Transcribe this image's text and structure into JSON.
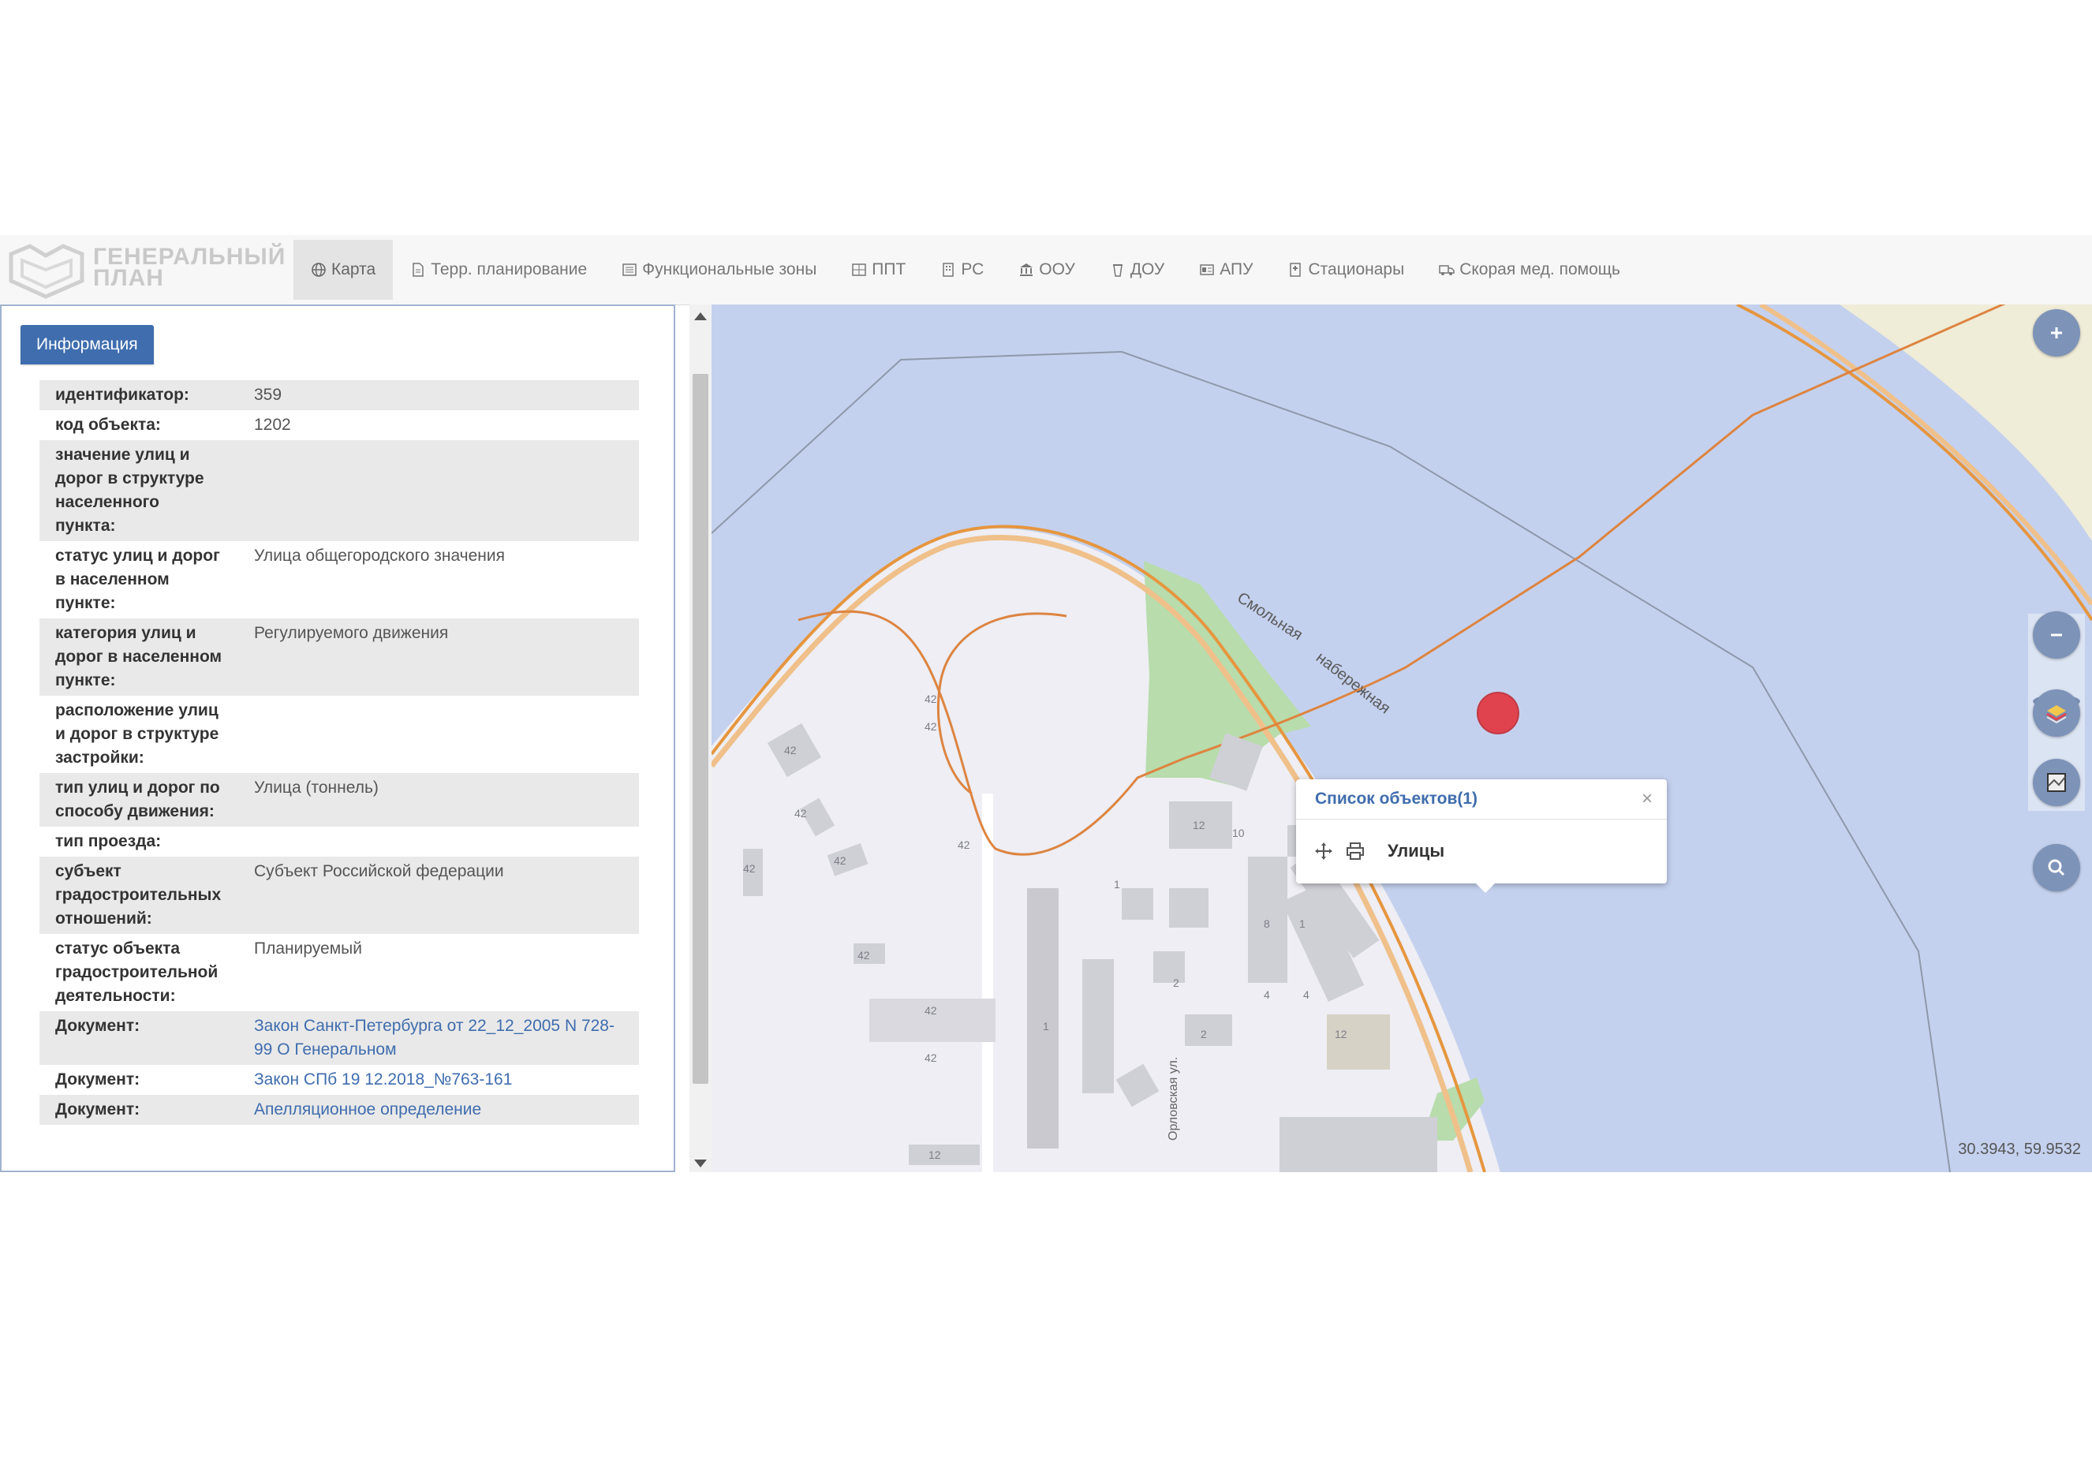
{
  "app": {
    "logo_line1": "ГЕНЕРАЛЬНЫЙ",
    "logo_line2": "ПЛАН"
  },
  "nav": [
    {
      "label": "Карта",
      "icon": "globe-icon",
      "active": true
    },
    {
      "label": "Терр. планирование",
      "icon": "document-icon"
    },
    {
      "label": "Функциональные зоны",
      "icon": "list-icon"
    },
    {
      "label": "ППТ",
      "icon": "grid-icon"
    },
    {
      "label": "РС",
      "icon": "building-icon"
    },
    {
      "label": "ООУ",
      "icon": "institution-icon"
    },
    {
      "label": "ДОУ",
      "icon": "child-icon"
    },
    {
      "label": "АПУ",
      "icon": "id-card-icon"
    },
    {
      "label": "Стационары",
      "icon": "hospital-icon"
    },
    {
      "label": "Скорая мед. помощь",
      "icon": "ambulance-icon"
    }
  ],
  "info": {
    "tab_label": "Информация",
    "rows": [
      {
        "key": "идентификатор:",
        "value": "359"
      },
      {
        "key": "код объекта:",
        "value": "1202"
      },
      {
        "key": "значение улиц и дорог в структуре населенного пункта:",
        "value": ""
      },
      {
        "key": "статус улиц и дорог в населенном пункте:",
        "value": "Улица общегородского значения"
      },
      {
        "key": "категория улиц и дорог в населенном пункте:",
        "value": "Регулируемого движения"
      },
      {
        "key": "расположение улиц и дорог в структуре застройки:",
        "value": ""
      },
      {
        "key": "тип улиц и дорог по способу движения:",
        "value": "Улица (тоннель)"
      },
      {
        "key": "тип проезда:",
        "value": ""
      },
      {
        "key": "субъект градостроительных отношений:",
        "value": "Субъект Российской федерации"
      },
      {
        "key": "статус объекта градостроительной деятельности:",
        "value": "Планируемый"
      },
      {
        "key": "Документ:",
        "value": "Закон Санкт-Петербурга от 22_12_2005 N 728-99 О Генеральном",
        "link": true
      },
      {
        "key": "Документ:",
        "value": "Закон СПб 19 12.2018_№763-161",
        "link": true
      },
      {
        "key": "Документ:",
        "value": "Апелляционное определение",
        "link": true
      }
    ]
  },
  "popup": {
    "title": "Список объектов(1)",
    "close": "×",
    "layer_label": "Улицы",
    "icons": [
      "move-icon",
      "print-icon"
    ]
  },
  "map": {
    "coordinates": "30.3943, 59.9532",
    "street_label": "Смольная",
    "street_label_2": "набережная",
    "side_street": "Орловская ул.",
    "building_numbers": [
      "42",
      "42",
      "42",
      "42",
      "42",
      "42",
      "42",
      "42",
      "42",
      "42",
      "12",
      "10",
      "1",
      "1",
      "8",
      "4",
      "2",
      "2",
      "4",
      "1",
      "12",
      "12"
    ],
    "controls": [
      "zoom-in-icon",
      "zoom-out-icon",
      "layers-icon",
      "map-frame-icon",
      "search-icon"
    ],
    "colors": {
      "water": "#c4d1ee",
      "land": "#eeeef4",
      "park": "#b8dcac",
      "road": "#e6963f",
      "marker": "#e0434e"
    }
  }
}
